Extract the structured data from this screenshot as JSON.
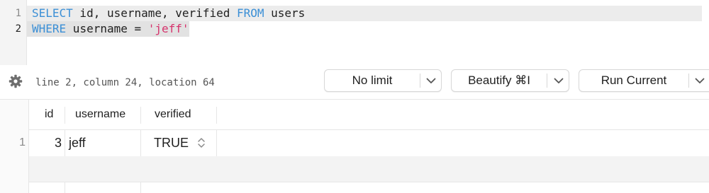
{
  "editor": {
    "line_numbers": [
      "1",
      "2"
    ],
    "line1": {
      "kw1": "SELECT",
      "t1": " id, username, verified ",
      "kw2": "FROM",
      "t2": " users"
    },
    "line2": {
      "kw1": "WHERE",
      "t1": " username = ",
      "str": "'jeff'"
    }
  },
  "toolbar": {
    "settings_icon": "gear-icon",
    "status": "line 2, column 24, location 64",
    "limit_label": "No limit",
    "beautify_label": "Beautify ⌘I",
    "run_label": "Run Current"
  },
  "results": {
    "columns": [
      "id",
      "username",
      "verified"
    ],
    "rows": [
      {
        "row_number": "1",
        "id": "3",
        "username": "jeff",
        "verified": "TRUE"
      }
    ]
  },
  "colors": {
    "keyword": "#3b8fd6",
    "string": "#d6336c"
  }
}
